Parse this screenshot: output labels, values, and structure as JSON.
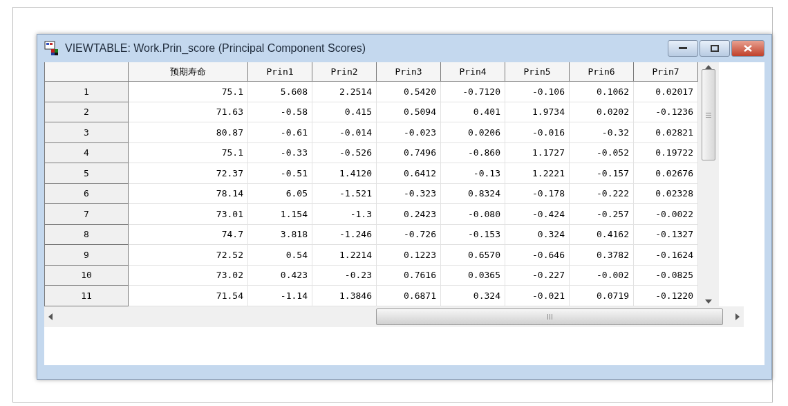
{
  "window": {
    "title": "VIEWTABLE: Work.Prin_score (Principal Component Scores)"
  },
  "table": {
    "columns": [
      "预期寿命",
      "Prin1",
      "Prin2",
      "Prin3",
      "Prin4",
      "Prin5",
      "Prin6",
      "Prin7"
    ],
    "rows": [
      {
        "label": "1",
        "cells": [
          "75.1",
          "5.608",
          "2.2514",
          "0.5420",
          "-0.7120",
          "-0.106",
          "0.1062",
          "0.02017"
        ]
      },
      {
        "label": "2",
        "cells": [
          "71.63",
          "-0.58",
          "0.415",
          "0.5094",
          "0.401",
          "1.9734",
          "0.0202",
          "-0.1236"
        ]
      },
      {
        "label": "3",
        "cells": [
          "80.87",
          "-0.61",
          "-0.014",
          "-0.023",
          "0.0206",
          "-0.016",
          "-0.32",
          "0.02821"
        ]
      },
      {
        "label": "4",
        "cells": [
          "75.1",
          "-0.33",
          "-0.526",
          "0.7496",
          "-0.860",
          "1.1727",
          "-0.052",
          "0.19722"
        ]
      },
      {
        "label": "5",
        "cells": [
          "72.37",
          "-0.51",
          "1.4120",
          "0.6412",
          "-0.13",
          "1.2221",
          "-0.157",
          "0.02676"
        ]
      },
      {
        "label": "6",
        "cells": [
          "78.14",
          "6.05",
          "-1.521",
          "-0.323",
          "0.8324",
          "-0.178",
          "-0.222",
          "0.02328"
        ]
      },
      {
        "label": "7",
        "cells": [
          "73.01",
          "1.154",
          "-1.3",
          "0.2423",
          "-0.080",
          "-0.424",
          "-0.257",
          "-0.0022"
        ]
      },
      {
        "label": "8",
        "cells": [
          "74.7",
          "3.818",
          "-1.246",
          "-0.726",
          "-0.153",
          "0.324",
          "0.4162",
          "-0.1327"
        ]
      },
      {
        "label": "9",
        "cells": [
          "72.52",
          "0.54",
          "1.2214",
          "0.1223",
          "0.6570",
          "-0.646",
          "0.3782",
          "-0.1624"
        ]
      },
      {
        "label": "10",
        "cells": [
          "73.02",
          "0.423",
          "-0.23",
          "0.7616",
          "0.0365",
          "-0.227",
          "-0.002",
          "-0.0825"
        ]
      },
      {
        "label": "11",
        "cells": [
          "71.54",
          "-1.14",
          "1.3846",
          "0.6871",
          "0.324",
          "-0.021",
          "0.0719",
          "-0.1220"
        ]
      }
    ]
  }
}
